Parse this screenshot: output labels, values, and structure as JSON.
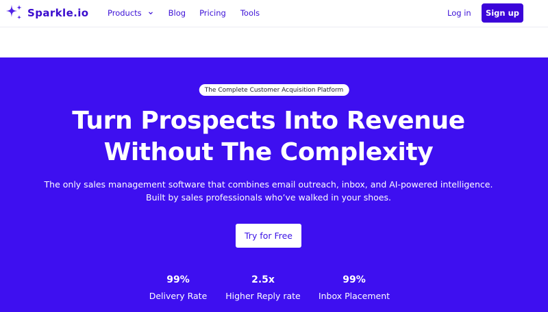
{
  "brand": {
    "name": "Sparkle.io",
    "logo_icon": "sparkle-icon",
    "accent": "#3e0ff0"
  },
  "nav": {
    "links": [
      {
        "label": "Products",
        "icon": "chevron-down-icon"
      },
      {
        "label": "Blog"
      },
      {
        "label": "Pricing"
      },
      {
        "label": "Tools"
      }
    ],
    "login_label": "Log in",
    "signup_label": "Sign up"
  },
  "hero": {
    "badge": "The Complete Customer Acquisition Platform",
    "headline_line1": "Turn Prospects Into Revenue",
    "headline_line2": "Without The Complexity",
    "subtitle_line1": "The only sales management software that combines email outreach, inbox, and AI-powered intelligence.",
    "subtitle_line2": "Built by sales professionals who’ve walked in your shoes.",
    "cta_label": "Try for Free",
    "stats": [
      {
        "value": "99%",
        "label": "Delivery Rate"
      },
      {
        "value": "2.5x",
        "label": "Higher Reply rate"
      },
      {
        "value": "99%",
        "label": "Inbox Placement"
      }
    ]
  }
}
